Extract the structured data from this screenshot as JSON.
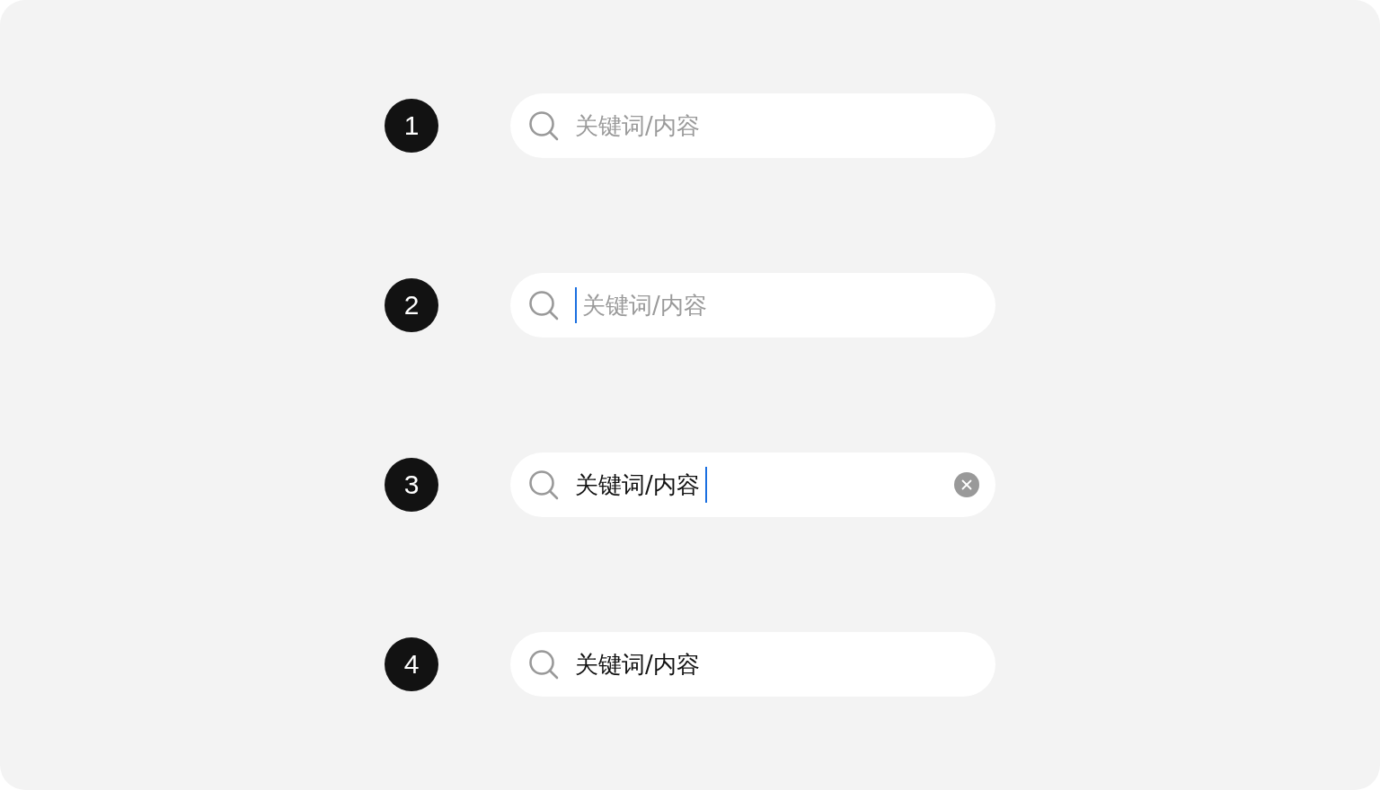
{
  "rows": [
    {
      "number": "1",
      "placeholder": "关键词/内容",
      "focused": false,
      "clear_button": false
    },
    {
      "number": "2",
      "placeholder": "关键词/内容",
      "focused": true,
      "clear_button": false
    },
    {
      "number": "3",
      "value": "关键词/内容",
      "focused": true,
      "clear_button": true
    },
    {
      "number": "4",
      "value": "关键词/内容",
      "focused": false,
      "clear_button": false
    }
  ]
}
